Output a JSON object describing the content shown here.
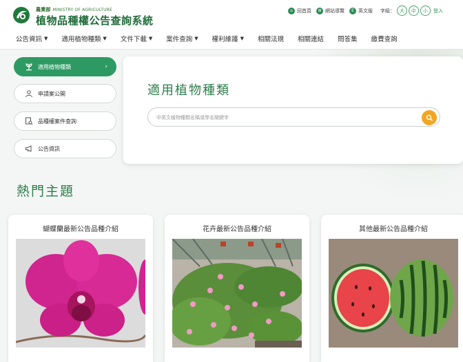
{
  "header": {
    "agency_zh": "農業部",
    "agency_en": "MINISTRY OF AGRICULTURE",
    "site_title": "植物品種權公告查詢系統",
    "utility_links": [
      {
        "label": "回首頁",
        "icon": "home-icon"
      },
      {
        "label": "網站導覽",
        "icon": "sitemap-icon"
      },
      {
        "label": "英文版",
        "icon": "english-icon"
      }
    ],
    "font_size_label": "字級：",
    "font_sizes": [
      "大",
      "中",
      "小"
    ],
    "cut_off_link": "登入"
  },
  "nav": {
    "items": [
      {
        "label": "公告資訊",
        "dropdown": true
      },
      {
        "label": "適用植物種類",
        "dropdown": true
      },
      {
        "label": "文件下載",
        "dropdown": true
      },
      {
        "label": "案件查詢",
        "dropdown": true
      },
      {
        "label": "權利維護",
        "dropdown": true
      },
      {
        "label": "相關法規",
        "dropdown": false
      },
      {
        "label": "相關連結",
        "dropdown": false
      },
      {
        "label": "問答集",
        "dropdown": false
      },
      {
        "label": "繳費查詢",
        "dropdown": false
      }
    ]
  },
  "sidebar": {
    "items": [
      {
        "label": "適用植物種類",
        "icon": "plant-icon",
        "active": true
      },
      {
        "label": "申請案公開",
        "icon": "person-icon",
        "active": false
      },
      {
        "label": "品種權案件查詢",
        "icon": "document-search-icon",
        "active": false
      },
      {
        "label": "公告資訊",
        "icon": "megaphone-icon",
        "active": false
      }
    ]
  },
  "search_panel": {
    "title": "適用植物種類",
    "placeholder": "中英文植物種類名稱或學名關鍵字"
  },
  "hot_topics": {
    "title": "熱門主題",
    "cards": [
      {
        "title": "蝴蝶蘭最新公告品種介紹",
        "image": "orchid"
      },
      {
        "title": "花卉最新公告品種介紹",
        "image": "flower-greenhouse"
      },
      {
        "title": "其他最新公告品種介紹",
        "image": "watermelon"
      }
    ]
  },
  "colors": {
    "brand_green": "#2e9a63",
    "title_green": "#2d7d4a",
    "search_orange": "#f2a623",
    "background": "#f4f6f5"
  }
}
